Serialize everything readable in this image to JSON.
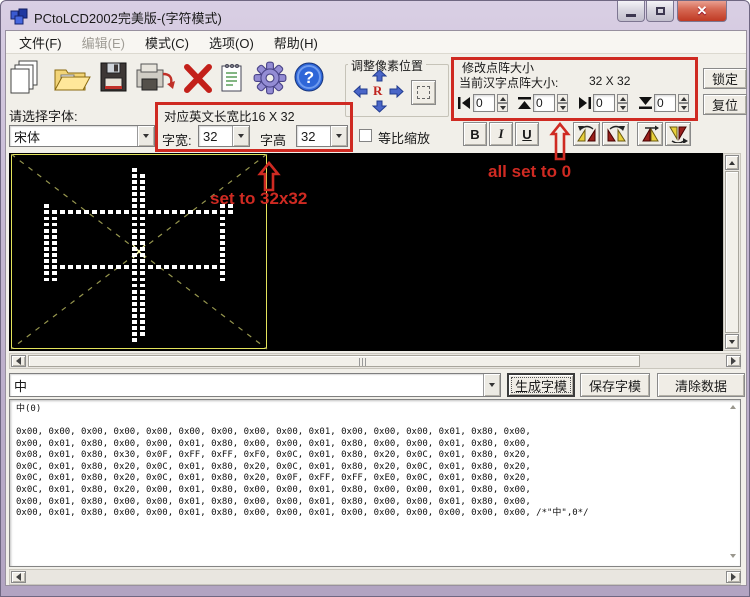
{
  "window": {
    "title": "PCtoLCD2002完美版-(字符模式)"
  },
  "menu": {
    "items": [
      {
        "label": "文件(F)",
        "enabled": true
      },
      {
        "label": "编辑(E)",
        "enabled": false
      },
      {
        "label": "模式(C)",
        "enabled": true
      },
      {
        "label": "选项(O)",
        "enabled": true
      },
      {
        "label": "帮助(H)",
        "enabled": true
      }
    ]
  },
  "toolbar": {
    "icons": [
      "new-document",
      "open-file",
      "save",
      "export-save",
      "delete",
      "notes",
      "settings-gear",
      "help"
    ],
    "group_adjust": {
      "label": "调整像素位置",
      "r_label": "R"
    },
    "group_matrix": {
      "label": "修改点阵大小",
      "current_label": "当前汉字点阵大小:",
      "current_value": "32 X 32",
      "spinners": [
        "0",
        "0",
        "0",
        "0"
      ]
    },
    "lock_label": "锁定",
    "reset_label": "复位"
  },
  "fontbar": {
    "select_label": "请选择字体:",
    "font_value": "宋体",
    "ratio_label": "对应英文长宽比16 X 32",
    "width_label": "字宽:",
    "width_value": "32",
    "height_label": "字高",
    "height_value": "32",
    "scale_label": "等比缩放",
    "bold": "B",
    "italic": "I",
    "underline": "U"
  },
  "annotations": {
    "set_size": "set to 32x32",
    "all_zero": "all set to 0"
  },
  "charbar": {
    "value": "中",
    "generate": "生成字模",
    "save": "保存字模",
    "clear": "清除数据"
  },
  "output": {
    "header": "中(0)",
    "lines": [
      "0x00, 0x00, 0x00, 0x00, 0x00, 0x00, 0x00, 0x00, 0x00, 0x01, 0x00, 0x00, 0x00, 0x01, 0x80, 0x00,",
      "0x00, 0x01, 0x80, 0x00, 0x00, 0x01, 0x80, 0x00, 0x00, 0x01, 0x80, 0x00, 0x00, 0x01, 0x80, 0x00,",
      "0x08, 0x01, 0x80, 0x30, 0x0F, 0xFF, 0xFF, 0xF0, 0x0C, 0x01, 0x80, 0x20, 0x0C, 0x01, 0x80, 0x20,",
      "0x0C, 0x01, 0x80, 0x20, 0x0C, 0x01, 0x80, 0x20, 0x0C, 0x01, 0x80, 0x20, 0x0C, 0x01, 0x80, 0x20,",
      "0x0C, 0x01, 0x80, 0x20, 0x0C, 0x01, 0x80, 0x20, 0x0F, 0xFF, 0xFF, 0xE0, 0x0C, 0x01, 0x80, 0x20,",
      "0x0C, 0x01, 0x80, 0x20, 0x00, 0x01, 0x80, 0x00, 0x00, 0x01, 0x80, 0x00, 0x00, 0x01, 0x80, 0x00,",
      "0x00, 0x01, 0x80, 0x00, 0x00, 0x01, 0x80, 0x00, 0x00, 0x01, 0x80, 0x00, 0x00, 0x01, 0x80, 0x00,",
      "0x00, 0x01, 0x80, 0x00, 0x00, 0x01, 0x80, 0x00, 0x00, 0x01, 0x00, 0x00, 0x00, 0x00, 0x00, 0x00, /*\"中\",0*/"
    ]
  },
  "colors": {
    "annotation_red": "#cf2a22",
    "guide_yellow": "#e4e45c",
    "dot_white": "#ffffff",
    "canvas_black": "#000000",
    "chrome_lavender": "#c4b7d2"
  }
}
